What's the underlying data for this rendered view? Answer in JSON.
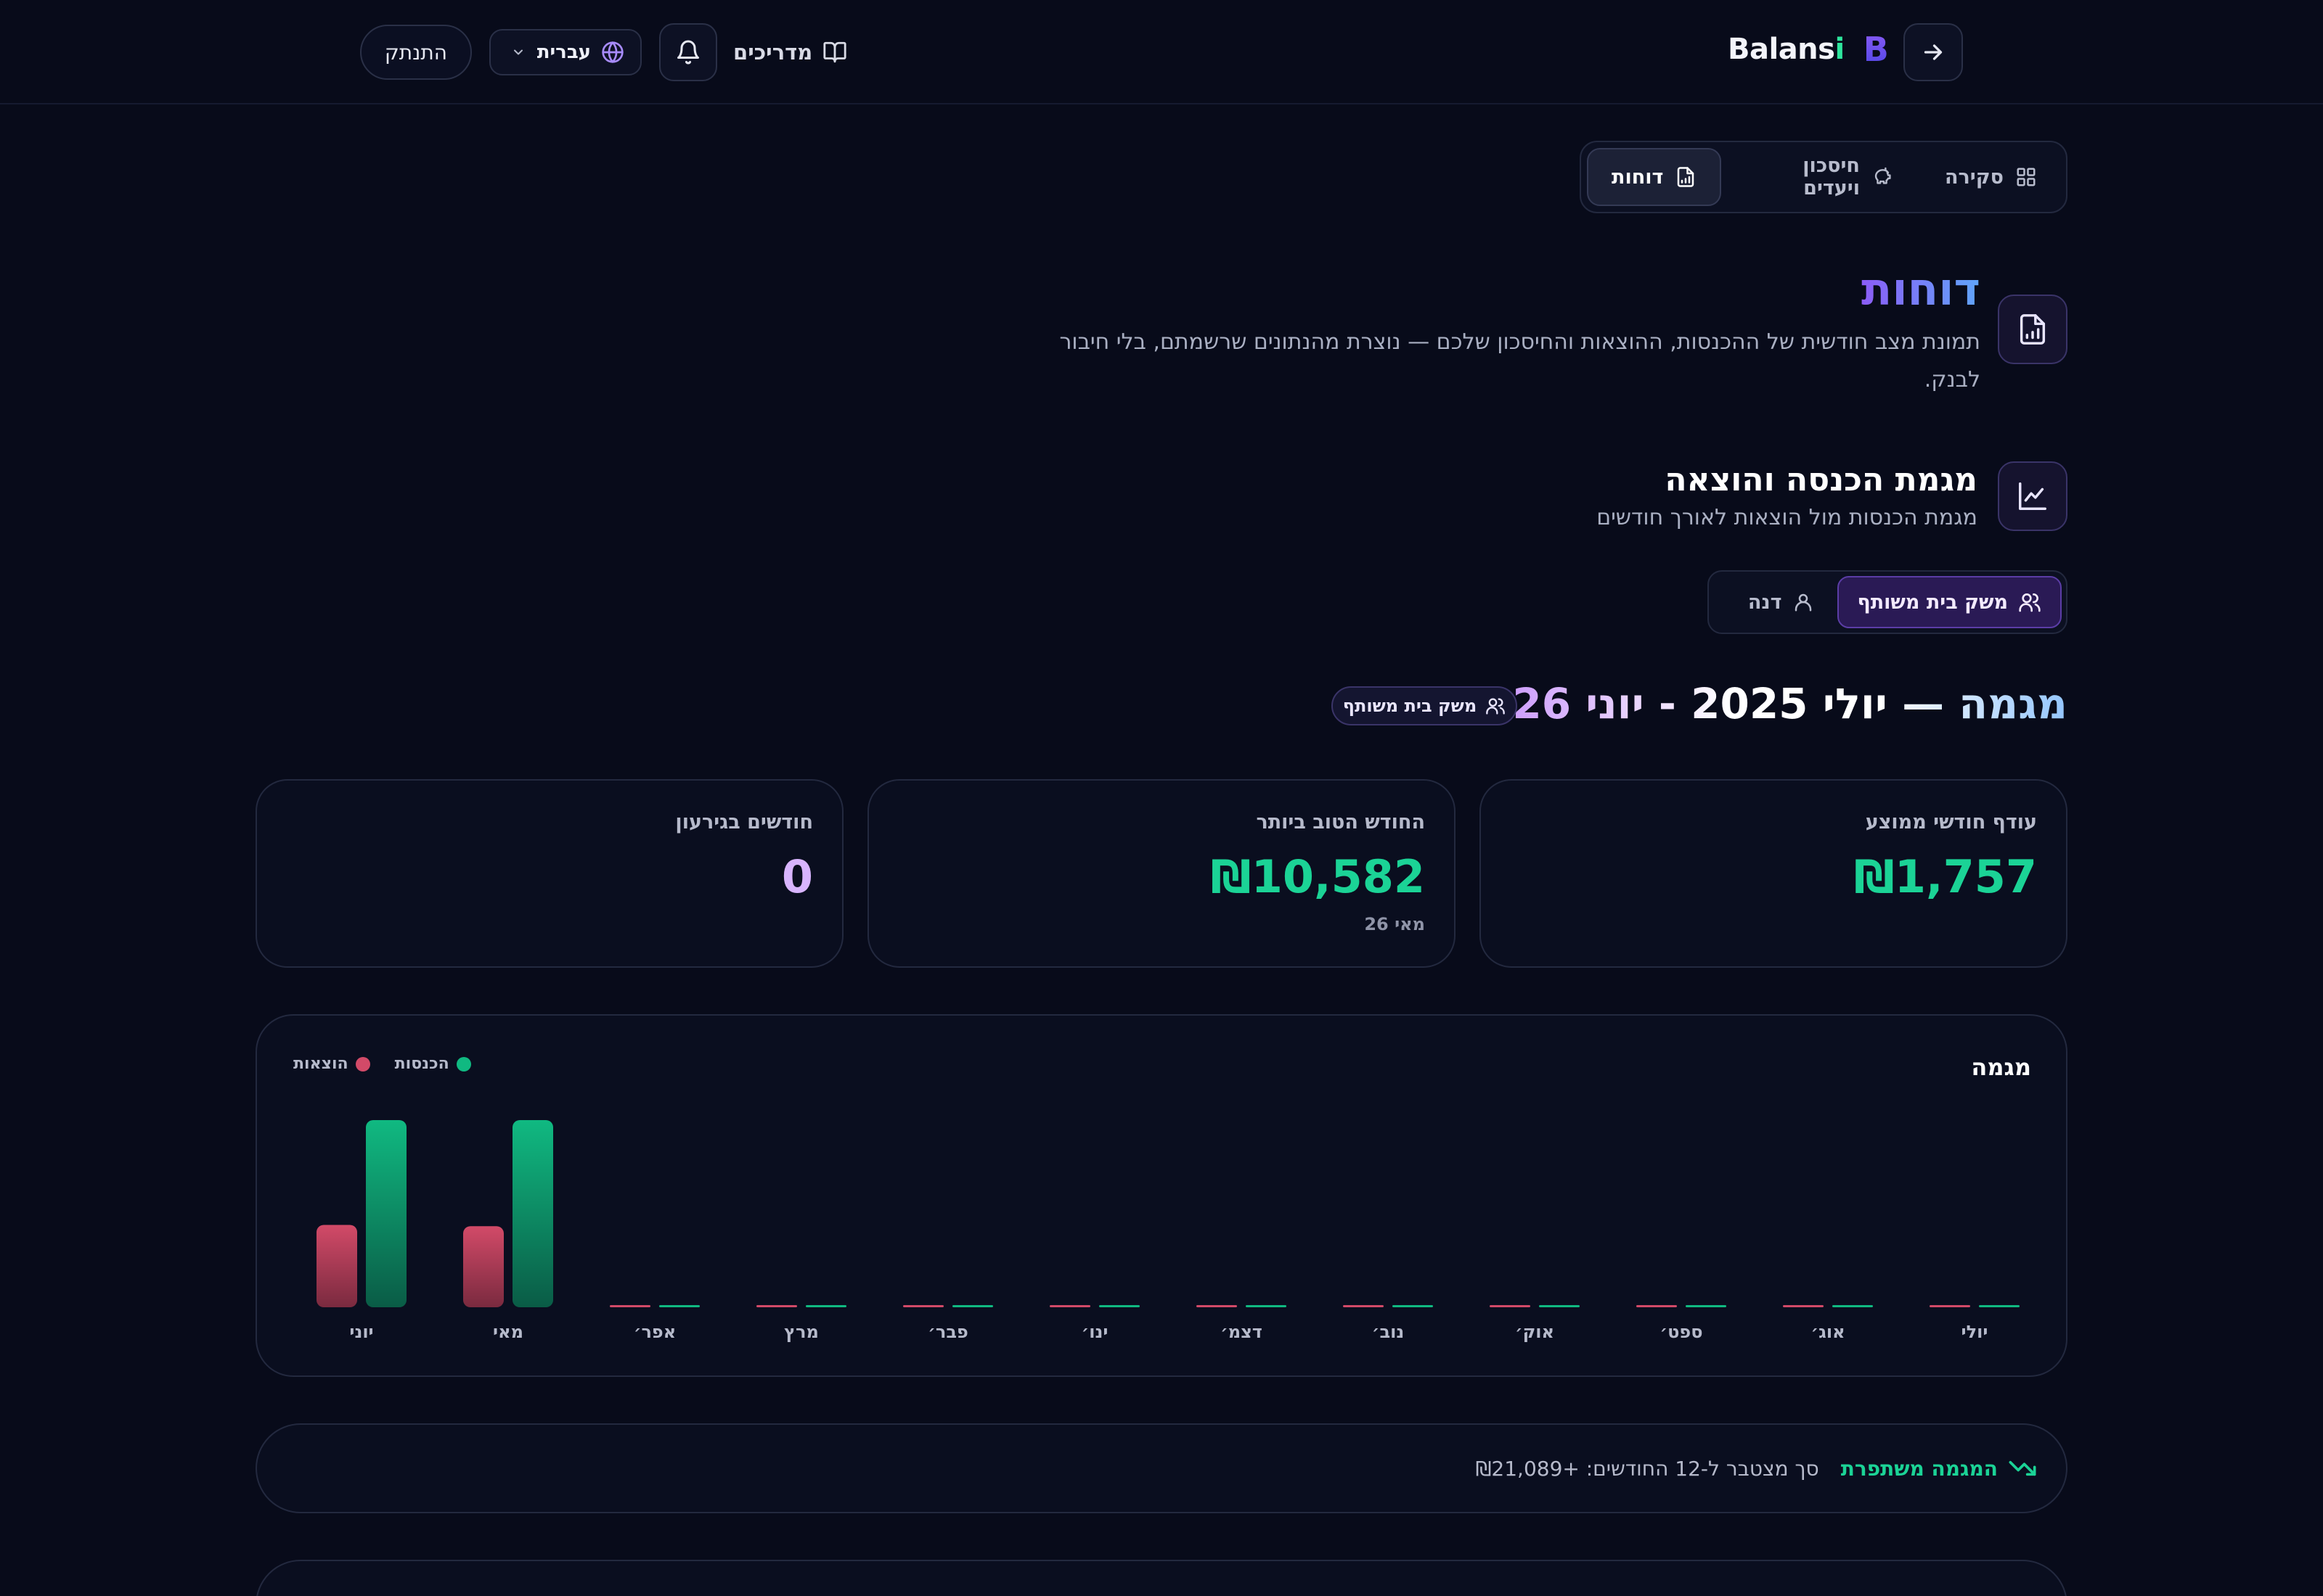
{
  "header": {
    "brand_name": "Balans",
    "brand_accent": "i",
    "brand_logo": "B",
    "guides_label": "מדריכים",
    "language": "עברית",
    "logout_label": "התנתק"
  },
  "tabs": [
    {
      "label": "סקירה",
      "icon": "grid-icon"
    },
    {
      "label": "חיסכון ויעדים",
      "icon": "piggy-bank-icon"
    },
    {
      "label": "דוחות",
      "icon": "report-icon",
      "active": true
    }
  ],
  "page": {
    "title": "דוחות",
    "subtitle": "תמונת מצב חודשית של ההכנסות, ההוצאות והחיסכון שלכם — נוצרת מהנתונים שרשמתם, בלי חיבור לבנק."
  },
  "section": {
    "title": "מגמת הכנסה והוצאה",
    "subtitle": "מגמת הכנסות מול הוצאות לאורך חודשים"
  },
  "scope": {
    "options": [
      {
        "label": "משק בית משותף",
        "active": true
      },
      {
        "label": "דנה",
        "active": false
      }
    ]
  },
  "range": {
    "title_prefix": "מגמה — ",
    "title_range": "יולי 2025 - יוני 2026",
    "badge": "משק בית משותף"
  },
  "stats": [
    {
      "label": "עודף חודשי ממוצע",
      "value": "₪1,757",
      "note": ""
    },
    {
      "label": "החודש הטוב ביותר",
      "value": "₪10,582",
      "note": "מאי 26"
    },
    {
      "label": "חודשים בגירעון",
      "value": "0",
      "note": ""
    }
  ],
  "chart": {
    "title": "מגמה",
    "legend_income": "הכנסות",
    "legend_expense": "הוצאות"
  },
  "colors": {
    "income": "#10b981",
    "expense": "#d24a68",
    "accent": "#8b5cf6"
  },
  "chart_data": {
    "type": "bar",
    "categories": [
      "יולי",
      "אוג׳",
      "ספט׳",
      "אוק׳",
      "נוב׳",
      "דצמ׳",
      "ינו׳",
      "פבר׳",
      "מרץ",
      "אפר׳",
      "מאי",
      "יוני"
    ],
    "series": [
      {
        "name": "הכנסות",
        "values": [
          0,
          0,
          0,
          0,
          0,
          0,
          0,
          0,
          0,
          0,
          15000,
          15000
        ]
      },
      {
        "name": "הוצאות",
        "values": [
          0,
          0,
          0,
          0,
          0,
          0,
          0,
          0,
          0,
          0,
          6500,
          6600
        ]
      }
    ],
    "ylim": [
      0,
      15000
    ],
    "grid": false,
    "legend": "top-left"
  },
  "trend": {
    "label": "המגמה משתפרת",
    "text": "סך מצטבר ל-12 החודשים: +₪21,089"
  }
}
